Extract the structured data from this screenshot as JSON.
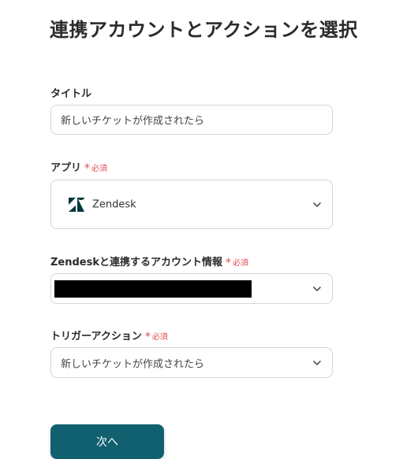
{
  "page": {
    "title": "連携アカウントとアクションを選択"
  },
  "fields": {
    "title": {
      "label": "タイトル",
      "value": "新しいチケットが作成されたら"
    },
    "app": {
      "label": "アプリ",
      "required": "必須",
      "value": "Zendesk"
    },
    "account": {
      "label": "Zendeskと連携するアカウント情報",
      "required": "必須"
    },
    "trigger": {
      "label": "トリガーアクション",
      "required": "必須",
      "value": "新しいチケットが作成されたら"
    }
  },
  "buttons": {
    "next": "次へ"
  },
  "colors": {
    "accent": "#11606f",
    "required": "#e5484d"
  }
}
